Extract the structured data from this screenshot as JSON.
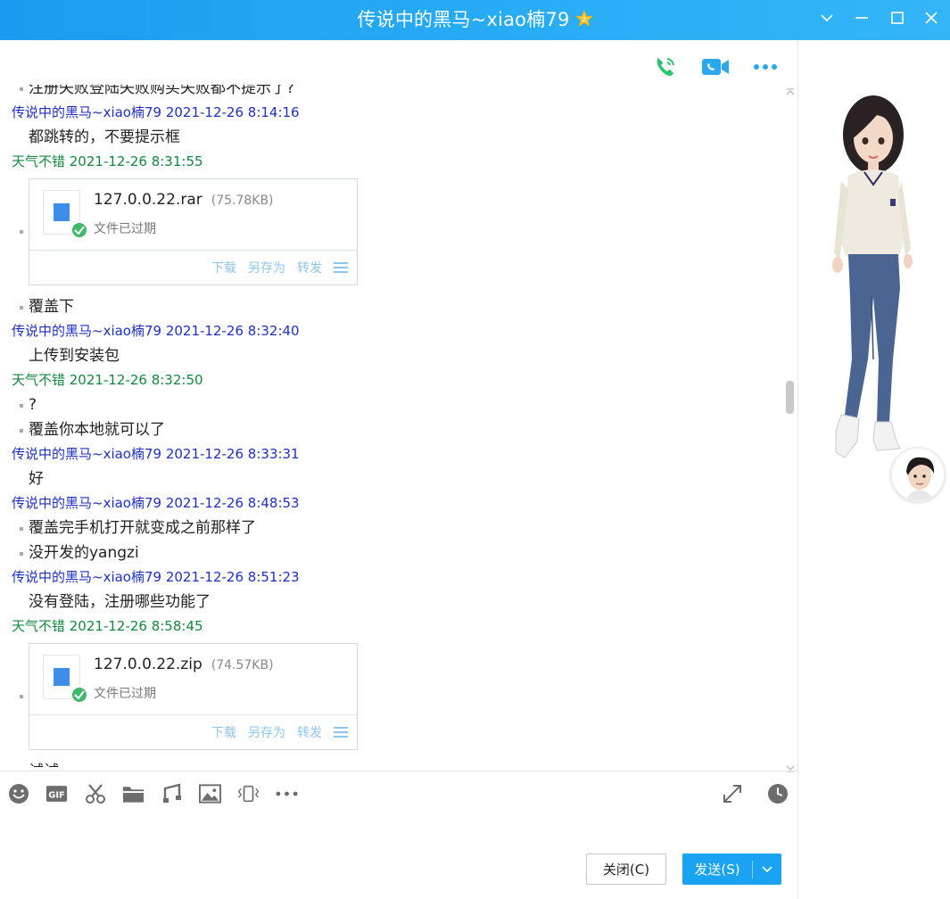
{
  "window": {
    "title": "传说中的黑马~xiao楠79"
  },
  "messages": [
    {
      "type": "text",
      "bullet": true,
      "text": "注册失败登陆失败购买失败都不提示了?"
    },
    {
      "type": "sender",
      "color": "blue",
      "text": "传说中的黑马~xiao楠79 2021-12-26 8:14:16"
    },
    {
      "type": "text",
      "bullet": false,
      "text": "都跳转的，不要提示框"
    },
    {
      "type": "sender",
      "color": "green",
      "text": "天气不错 2021-12-26 8:31:55"
    },
    {
      "type": "file",
      "name": "127.0.0.22.rar",
      "size": "(75.78KB)",
      "status": "文件已过期"
    },
    {
      "type": "text",
      "bullet": true,
      "text": "覆盖下"
    },
    {
      "type": "sender",
      "color": "blue",
      "text": "传说中的黑马~xiao楠79 2021-12-26 8:32:40"
    },
    {
      "type": "text",
      "bullet": false,
      "text": "上传到安装包"
    },
    {
      "type": "sender",
      "color": "green",
      "text": "天气不错 2021-12-26 8:32:50"
    },
    {
      "type": "text",
      "bullet": true,
      "text": "?"
    },
    {
      "type": "text",
      "bullet": true,
      "text": "覆盖你本地就可以了"
    },
    {
      "type": "sender",
      "color": "blue",
      "text": "传说中的黑马~xiao楠79 2021-12-26 8:33:31"
    },
    {
      "type": "text",
      "bullet": false,
      "text": "好"
    },
    {
      "type": "sender",
      "color": "blue",
      "text": "传说中的黑马~xiao楠79 2021-12-26 8:48:53"
    },
    {
      "type": "text",
      "bullet": true,
      "text": "覆盖完手机打开就变成之前那样了"
    },
    {
      "type": "text",
      "bullet": true,
      "text": "没开发的yangzi"
    },
    {
      "type": "sender",
      "color": "blue",
      "text": "传说中的黑马~xiao楠79 2021-12-26 8:51:23"
    },
    {
      "type": "text",
      "bullet": false,
      "text": "没有登陆，注册哪些功能了"
    },
    {
      "type": "sender",
      "color": "green",
      "text": "天气不错 2021-12-26 8:58:45"
    },
    {
      "type": "file",
      "name": "127.0.0.22.zip",
      "size": "(74.57KB)",
      "status": "文件已过期"
    },
    {
      "type": "text",
      "bullet": true,
      "text": "试试"
    }
  ],
  "file_actions": {
    "download": "下载",
    "save_as": "另存为",
    "forward": "转发"
  },
  "buttons": {
    "close": "关闭(C)",
    "send": "发送(S)"
  },
  "colors": {
    "titlebar": "#1a9cf0",
    "sender_blue": "#1d2fc8",
    "sender_green": "#11893c",
    "send_button": "#1aa3f2",
    "file_action": "#8cc6ee"
  },
  "icons": {
    "call_bar": [
      "voice-call-icon",
      "video-call-icon",
      "more-icon"
    ],
    "toolbar": [
      "emoji-icon",
      "gif-icon",
      "screenshot-scissors-icon",
      "folder-icon",
      "music-icon",
      "image-icon",
      "shake-icon",
      "more-icon"
    ],
    "toolbar_right": [
      "expand-icon",
      "history-clock-icon"
    ]
  }
}
